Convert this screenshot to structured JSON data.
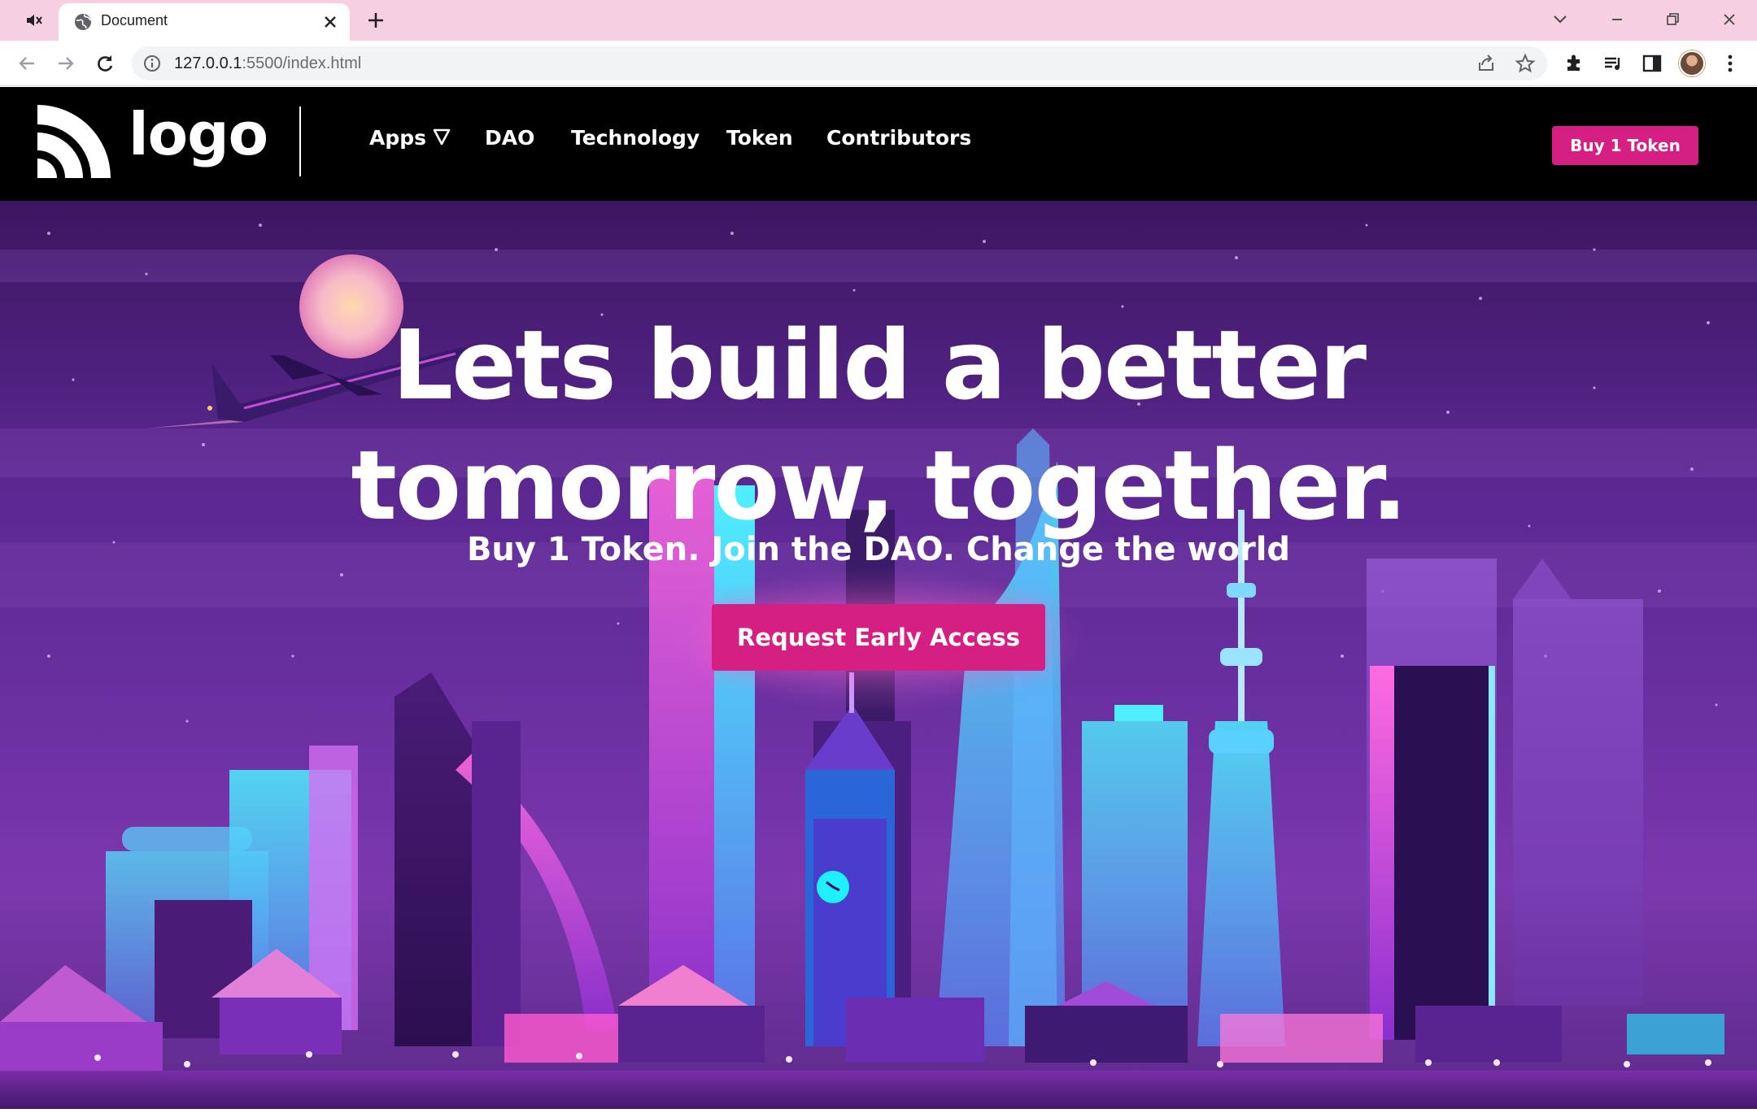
{
  "browser": {
    "tab_title": "Document",
    "url_host": "127.0.0.1",
    "url_rest": ":5500/index.html"
  },
  "site": {
    "logo_text": "logo",
    "nav": [
      {
        "label": "Apps"
      },
      {
        "label": "DAO"
      },
      {
        "label": "Technology"
      },
      {
        "label": "Token"
      },
      {
        "label": "Contributors"
      }
    ],
    "buy_button": "Buy 1 Token"
  },
  "hero": {
    "title_line1": "Lets build a better",
    "title_line2": "tomorrow, together.",
    "subtitle": "Buy 1 Token. Join the DAO. Change the world",
    "cta": "Request Early Access"
  },
  "colors": {
    "accent": "#d51f83",
    "header_bg": "#000000",
    "tabbar_bg": "#f6cfe0"
  }
}
